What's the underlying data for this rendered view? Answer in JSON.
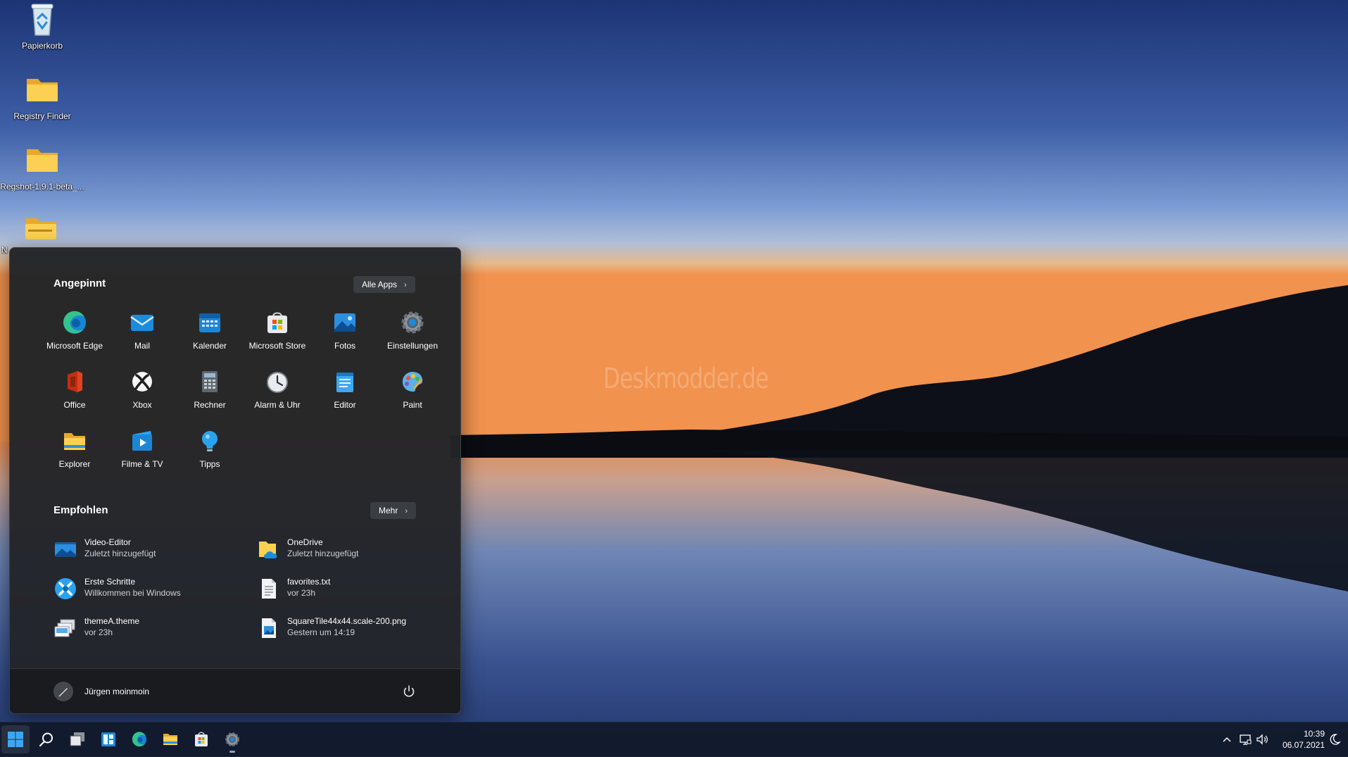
{
  "desktop": {
    "icons": [
      {
        "label": "Papierkorb",
        "icon": "recycle-bin-icon"
      },
      {
        "label": "Registry Finder",
        "icon": "folder-icon"
      },
      {
        "label": "Regshot-1.9.1-beta_...",
        "icon": "folder-icon"
      },
      {
        "label": "N",
        "icon": "zip-folder-icon"
      }
    ],
    "watermark": "Deskmodder.de"
  },
  "start_menu": {
    "pinned_title": "Angepinnt",
    "all_apps_label": "Alle Apps",
    "pinned_apps": [
      {
        "label": "Microsoft Edge",
        "icon": "edge-icon"
      },
      {
        "label": "Mail",
        "icon": "mail-icon"
      },
      {
        "label": "Kalender",
        "icon": "calendar-icon"
      },
      {
        "label": "Microsoft Store",
        "icon": "store-icon"
      },
      {
        "label": "Fotos",
        "icon": "photos-icon"
      },
      {
        "label": "Einstellungen",
        "icon": "settings-icon"
      },
      {
        "label": "Office",
        "icon": "office-icon"
      },
      {
        "label": "Xbox",
        "icon": "xbox-icon"
      },
      {
        "label": "Rechner",
        "icon": "calculator-icon"
      },
      {
        "label": "Alarm & Uhr",
        "icon": "clock-icon"
      },
      {
        "label": "Editor",
        "icon": "notepad-icon"
      },
      {
        "label": "Paint",
        "icon": "paint-icon"
      },
      {
        "label": "Explorer",
        "icon": "explorer-icon"
      },
      {
        "label": "Filme & TV",
        "icon": "movies-icon"
      },
      {
        "label": "Tipps",
        "icon": "tips-icon"
      }
    ],
    "recommended_title": "Empfohlen",
    "more_label": "Mehr",
    "recommended": [
      {
        "title": "Video-Editor",
        "subtitle": "Zuletzt hinzugefügt",
        "icon": "video-editor-icon"
      },
      {
        "title": "OneDrive",
        "subtitle": "Zuletzt hinzugefügt",
        "icon": "onedrive-icon"
      },
      {
        "title": "Erste Schritte",
        "subtitle": "Willkommen bei Windows",
        "icon": "get-started-icon"
      },
      {
        "title": "favorites.txt",
        "subtitle": "vor 23h",
        "icon": "text-file-icon"
      },
      {
        "title": "themeA.theme",
        "subtitle": "vor 23h",
        "icon": "theme-file-icon"
      },
      {
        "title": "SquareTile44x44.scale-200.png",
        "subtitle": "Gestern um 14:19",
        "icon": "image-file-icon"
      }
    ],
    "user_name": "Jürgen moinmoin"
  },
  "taskbar": {
    "buttons": [
      "start-icon",
      "search-icon",
      "task-view-icon",
      "widgets-icon",
      "edge-icon",
      "explorer-icon",
      "store-icon",
      "settings-icon"
    ],
    "time": "10:39",
    "date": "06.07.2021",
    "tray": [
      "chevron-up-icon",
      "network-icon",
      "volume-icon",
      "notifications-icon"
    ]
  },
  "colors": {
    "accent": "#0078d4",
    "start_bg": "#222428",
    "taskbar_bg": "#121a2c"
  }
}
